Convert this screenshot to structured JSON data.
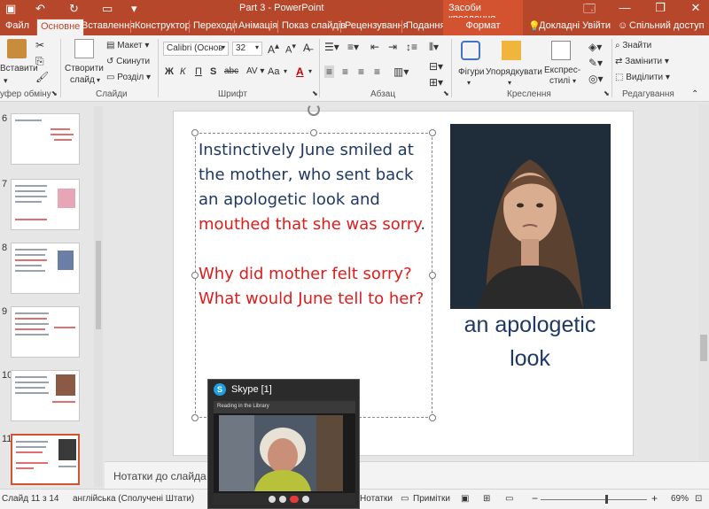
{
  "window": {
    "document_title": "Part 3 - PowerPoint",
    "context_title": "Засоби креслення",
    "controls": [
      "🗔",
      "—",
      "❐",
      "✕"
    ]
  },
  "tabs": [
    {
      "label": "Файл"
    },
    {
      "label": "Основне"
    },
    {
      "label": "Вставлення"
    },
    {
      "label": "Конструктор"
    },
    {
      "label": "Переходи"
    },
    {
      "label": "Анімація"
    },
    {
      "label": "Показ слайдів"
    },
    {
      "label": "Рецензування"
    },
    {
      "label": "Подання"
    },
    {
      "label": "Формат"
    }
  ],
  "tab_right": {
    "tell_me": "Докладні",
    "sign_in": "Увійти",
    "share": "Спільний доступ"
  },
  "ribbon": {
    "clipboard": {
      "paste": "Вставити",
      "label": "уфер обміну"
    },
    "slides": {
      "new_slide_1": "Створити",
      "new_slide_2": "слайд",
      "layout": "Макет",
      "reset": "Скинути",
      "section": "Розділ",
      "label": "Слайди"
    },
    "font": {
      "font_name": "Calibri (Основ",
      "font_size": "32",
      "label": "Шрифт",
      "bold": "Ж",
      "italic": "К",
      "underline": "П",
      "strike": "S",
      "spacing": "abc",
      "change_case": "Aa"
    },
    "paragraph": {
      "label": "Абзац"
    },
    "drawing": {
      "shapes": "Фігури",
      "arrange": "Упорядкувати",
      "styles_1": "Експрес-",
      "styles_2": "стилі",
      "label": "Креслення"
    },
    "editing": {
      "find": "Знайти",
      "replace": "Замінити",
      "select": "Виділити",
      "label": "Редагування"
    }
  },
  "thumbnails": [
    {
      "num": "6"
    },
    {
      "num": "7"
    },
    {
      "num": "8"
    },
    {
      "num": "9"
    },
    {
      "num": "10"
    },
    {
      "num": "11"
    }
  ],
  "slide": {
    "para1_blue": "Instinctively June smiled at the mother, who sent back an apologetic look and ",
    "para1_red": "mouthed that she was sorry",
    "para1_end": ".",
    "question1": "Why did mother felt sorry?",
    "question2": "What would June tell to her?",
    "caption": "an apologetic look"
  },
  "notes": {
    "placeholder": "Нотатки до слайда"
  },
  "status": {
    "slide_info": "Слайд 11 з 14",
    "language": "англійська (Сполучені Штати)",
    "notes": "Нотатки",
    "comments": "Примітки",
    "zoom": "69%"
  },
  "skype": {
    "title": "Skype [1]",
    "meeting_title": "Reading in the Library"
  },
  "colors": {
    "accent": "#b7472a",
    "context_tab": "#d35230",
    "slide_blue": "#1f3864",
    "slide_red": "#e21b1b"
  }
}
